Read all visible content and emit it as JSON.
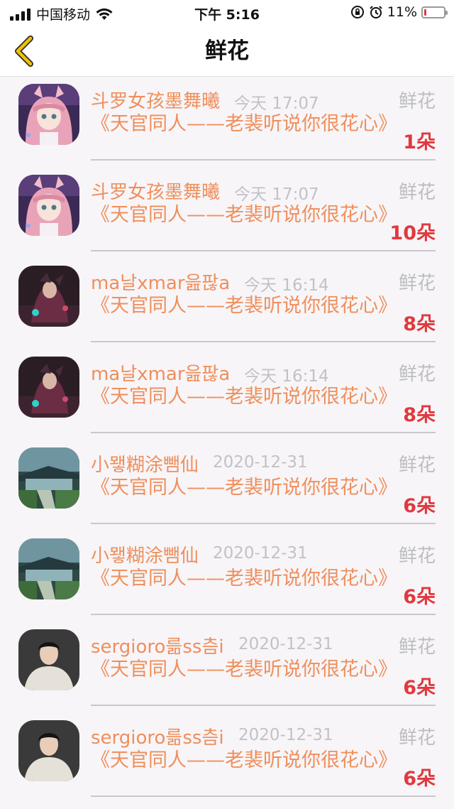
{
  "status_bar": {
    "carrier": "中国移动",
    "time": "下午 5:16",
    "battery_percent": "11%",
    "battery_level": 0.11,
    "icons": [
      "signal-icon",
      "wifi-icon",
      "rotation-lock-icon",
      "alarm-icon",
      "battery-icon"
    ]
  },
  "nav": {
    "title": "鲜花",
    "back_icon": "chevron-left-icon",
    "accent_color": "#f2c200"
  },
  "colors": {
    "name": "#ef8f5c",
    "count": "#e0393f",
    "muted": "#c2c2c6"
  },
  "records": [
    {
      "name": "斗罗女孩墨舞曦",
      "time": "今天 17:07",
      "type": "鲜花",
      "book": "《天官同人——老裴听说你很花心》",
      "count": "1朵",
      "avatar": "anime-girl-avatar"
    },
    {
      "name": "斗罗女孩墨舞曦",
      "time": "今天 17:07",
      "type": "鲜花",
      "book": "《天官同人——老裴听说你很花心》",
      "count": "10朵",
      "avatar": "anime-girl-avatar"
    },
    {
      "name": "ma날xmar읊팒a",
      "time": "今天 16:14",
      "type": "鲜花",
      "book": "《天官同人——老裴听说你很花心》",
      "count": "8朵",
      "avatar": "dark-character-avatar"
    },
    {
      "name": "ma날xmar읊팒a",
      "time": "今天 16:14",
      "type": "鲜花",
      "book": "《天官同人——老裴听说你很花心》",
      "count": "8朵",
      "avatar": "dark-character-avatar"
    },
    {
      "name": "小뫻糊涂뺌仙",
      "time": "2020-12-31",
      "type": "鲜花",
      "book": "《天官同人——老裴听说你很花心》",
      "count": "6朵",
      "avatar": "scenery-avatar"
    },
    {
      "name": "小뫻糊涂뺌仙",
      "time": "2020-12-31",
      "type": "鲜花",
      "book": "《天官同人——老裴听说你很花心》",
      "count": "6朵",
      "avatar": "scenery-avatar"
    },
    {
      "name": "sergioro륾ss츰i",
      "time": "2020-12-31",
      "type": "鲜花",
      "book": "《天官同人——老裴听说你很花心》",
      "count": "6朵",
      "avatar": "portrait-avatar"
    },
    {
      "name": "sergioro륾ss츰i",
      "time": "2020-12-31",
      "type": "鲜花",
      "book": "《天官同人——老裴听说你很花心》",
      "count": "6朵",
      "avatar": "portrait-avatar"
    }
  ]
}
